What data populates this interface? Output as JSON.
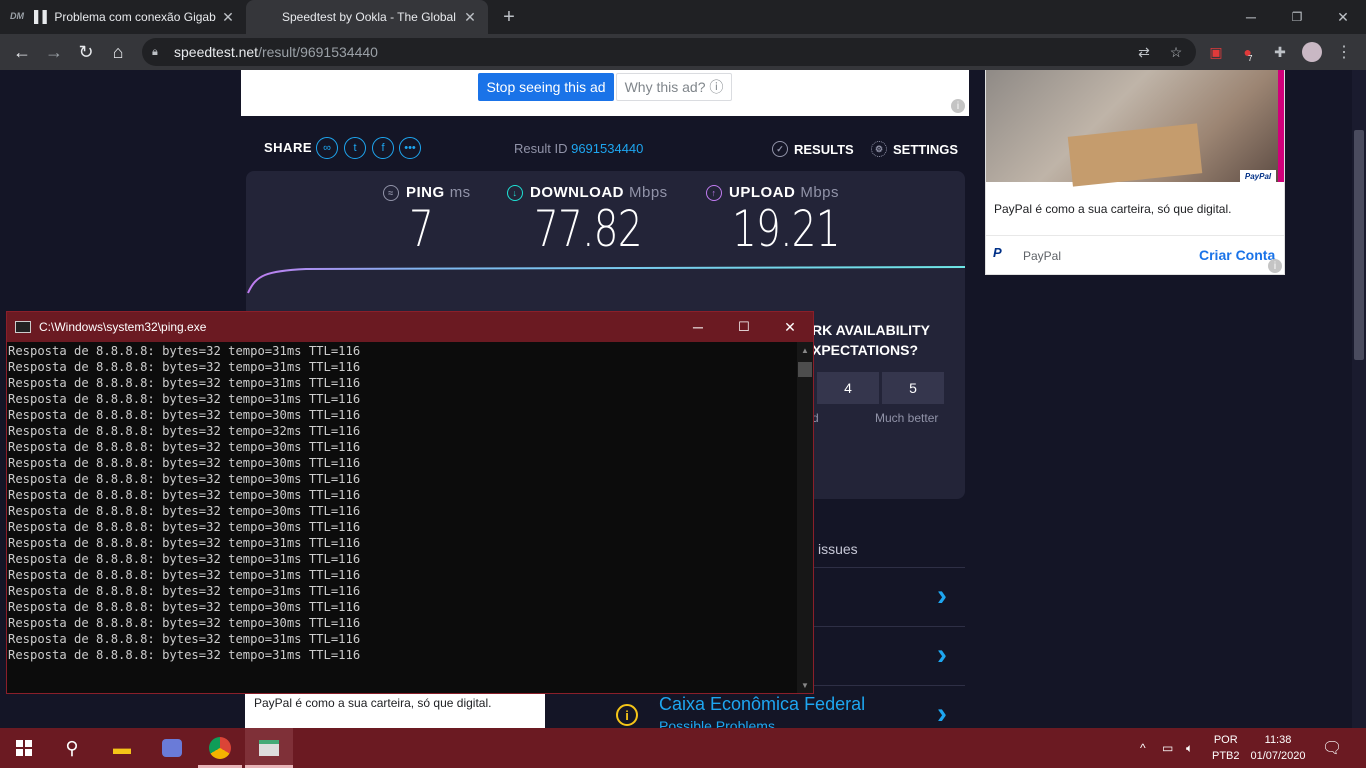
{
  "browser": {
    "tabs": [
      {
        "title": "▌▌ Problema com conexão Gigab",
        "favicon": "DM"
      },
      {
        "title": "Speedtest by Ookla - The Global"
      }
    ],
    "new_tab": "+",
    "url_host": "speedtest.net",
    "url_path": "/result/9691534440",
    "extension_badge": "7"
  },
  "ad_top": {
    "stop_label": "Stop seeing this ad",
    "why_label": "Why this ad? ⓘ"
  },
  "share": {
    "label": "SHARE",
    "result_id_label": "Result ID",
    "result_id": "9691534440",
    "results_label": "RESULTS",
    "settings_label": "SETTINGS"
  },
  "metrics": {
    "ping": {
      "label": "PING",
      "unit": "ms",
      "value": "7"
    },
    "download": {
      "label": "DOWNLOAD",
      "unit": "Mbps",
      "value": "77.82"
    },
    "upload": {
      "label": "UPLOAD",
      "unit": "Mbps",
      "value": "19.21"
    }
  },
  "survey": {
    "question_line1": "RK AVAILABILITY",
    "question_line2": "XPECTATIONS?",
    "options": [
      "4",
      "5"
    ],
    "left_label": "d",
    "right_label": "Much better"
  },
  "issues": {
    "heading": "issues",
    "isp_name": "Caixa Econômica Federal",
    "isp_sub": "Possible Problems"
  },
  "ad_right": {
    "badge": "PayPal",
    "text": "PayPal é como a sua carteira, só que digital.",
    "brand": "PayPal",
    "cta": "Criar Conta"
  },
  "ad_bottom": {
    "text": "PayPal é como a sua carteira, só que digital."
  },
  "console": {
    "title": "C:\\Windows\\system32\\ping.exe",
    "lines": [
      "Resposta de 8.8.8.8: bytes=32 tempo=31ms TTL=116",
      "Resposta de 8.8.8.8: bytes=32 tempo=31ms TTL=116",
      "Resposta de 8.8.8.8: bytes=32 tempo=31ms TTL=116",
      "Resposta de 8.8.8.8: bytes=32 tempo=31ms TTL=116",
      "Resposta de 8.8.8.8: bytes=32 tempo=30ms TTL=116",
      "Resposta de 8.8.8.8: bytes=32 tempo=32ms TTL=116",
      "Resposta de 8.8.8.8: bytes=32 tempo=30ms TTL=116",
      "Resposta de 8.8.8.8: bytes=32 tempo=30ms TTL=116",
      "Resposta de 8.8.8.8: bytes=32 tempo=30ms TTL=116",
      "Resposta de 8.8.8.8: bytes=32 tempo=30ms TTL=116",
      "Resposta de 8.8.8.8: bytes=32 tempo=30ms TTL=116",
      "Resposta de 8.8.8.8: bytes=32 tempo=30ms TTL=116",
      "Resposta de 8.8.8.8: bytes=32 tempo=31ms TTL=116",
      "Resposta de 8.8.8.8: bytes=32 tempo=31ms TTL=116",
      "Resposta de 8.8.8.8: bytes=32 tempo=31ms TTL=116",
      "Resposta de 8.8.8.8: bytes=32 tempo=31ms TTL=116",
      "Resposta de 8.8.8.8: bytes=32 tempo=30ms TTL=116",
      "Resposta de 8.8.8.8: bytes=32 tempo=30ms TTL=116",
      "Resposta de 8.8.8.8: bytes=32 tempo=31ms TTL=116",
      "Resposta de 8.8.8.8: bytes=32 tempo=31ms TTL=116"
    ]
  },
  "taskbar": {
    "lang_line1": "POR",
    "lang_line2": "PTB2",
    "time": "11:38",
    "date": "01/07/2020"
  },
  "colors": {
    "accent": "#1ea6f0",
    "background": "#141526",
    "panel": "#232438",
    "console_title": "#6b1a22",
    "upload_purple": "#c07bf0"
  }
}
